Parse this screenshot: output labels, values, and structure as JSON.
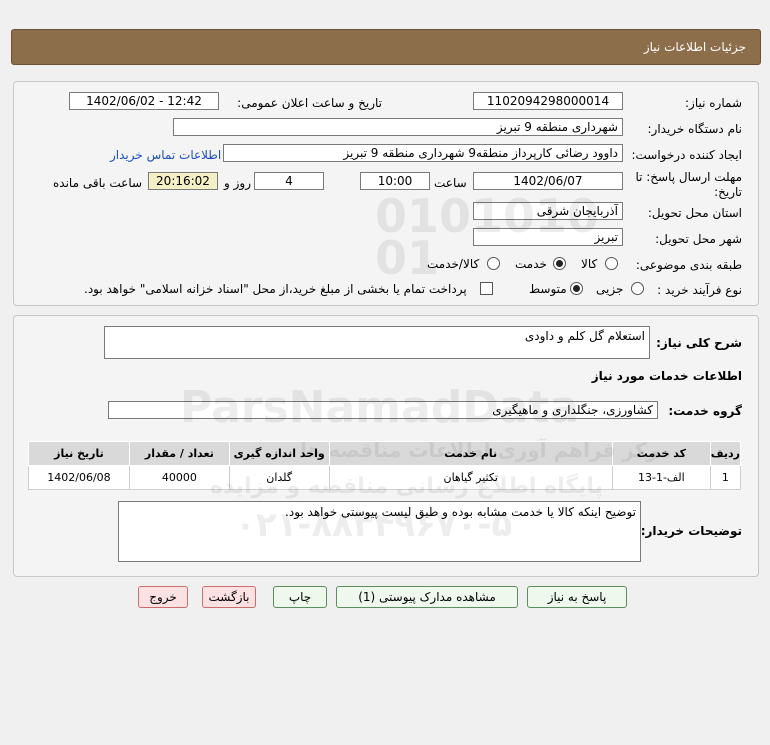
{
  "header": {
    "title": "جزئیات اطلاعات نیاز"
  },
  "form": {
    "need_number_label": "شماره نیاز:",
    "need_number": "1102094298000014",
    "announce_label": "تاریخ و ساعت اعلان عمومی:",
    "announce_value": "1402/06/02 - 12:42",
    "buyer_org_label": "نام دستگاه خریدار:",
    "buyer_org": "شهرداری منطقه 9 تبریز",
    "creator_label": "ایجاد کننده درخواست:",
    "creator": "داوود رضائی کارپرداز منطقه9 شهرداری منطقه 9 تبریز",
    "contact_link": "اطلاعات تماس خریدار",
    "deadline_label_1": "مهلت ارسال پاسخ: تا",
    "deadline_label_2": "تاریخ:",
    "deadline_date": "1402/06/07",
    "time_label": "ساعت",
    "deadline_time": "10:00",
    "days_value": "4",
    "days_label": "روز و",
    "remaining_time": "20:16:02",
    "remaining_label": "ساعت باقی مانده",
    "province_label": "استان محل تحویل:",
    "province": "آذربایجان شرقی",
    "city_label": "شهر محل تحویل:",
    "city": "تبریز",
    "category_label": "طبقه بندی موضوعی:",
    "category_options": [
      "کالا",
      "خدمت",
      "کالا/خدمت"
    ],
    "category_selected": "خدمت",
    "process_label": "نوع فرآیند خرید :",
    "process_options": [
      "جزیی",
      "متوسط"
    ],
    "process_selected": "متوسط",
    "payment_text": "پرداخت تمام یا بخشی از مبلغ خرید،از محل \"اسناد خزانه اسلامی\" خواهد بود."
  },
  "details": {
    "summary_label": "شرح کلی نیاز:",
    "summary": "استعلام گل کلم و داودی",
    "services_title": "اطلاعات خدمات مورد نیاز",
    "service_group_label": "گروه خدمت:",
    "service_group": "کشاورزی، جنگلداری و ماهیگیری",
    "table": {
      "headers": [
        "ردیف",
        "کد خدمت",
        "نام خدمت",
        "واحد اندازه گیری",
        "تعداد / مقدار",
        "تاریخ نیاز"
      ],
      "rows": [
        [
          "1",
          "الف-1-13",
          "تکثیر گیاهان",
          "گلدان",
          "40000",
          "1402/06/08"
        ]
      ]
    },
    "buyer_notes_label": "توضیحات خریدار:",
    "buyer_notes": "توضیح اینکه کالا یا خدمت مشابه بوده و طبق لیست پیوستی خواهد بود."
  },
  "buttons": {
    "reply": "پاسخ به نیاز",
    "attachments": "مشاهده مدارک پیوستی (1)",
    "print": "چاپ",
    "back": "بازگشت",
    "exit": "خروج"
  },
  "watermark": {
    "brand": "ParsNamadData",
    "line1": "مرکز فراهم آوری اطلاعات مناقصه ها",
    "line2": "پایگاه اطلاع رسانی مناقصه و مزایده",
    "phone": "۰۲۱-۸۸۳۴۹۶۷۰-۵",
    "digits": "010101001"
  },
  "colors": {
    "header_bg": "#8d6e4a",
    "link": "#1a4fbf",
    "remaining_bg": "#f5efc6"
  }
}
